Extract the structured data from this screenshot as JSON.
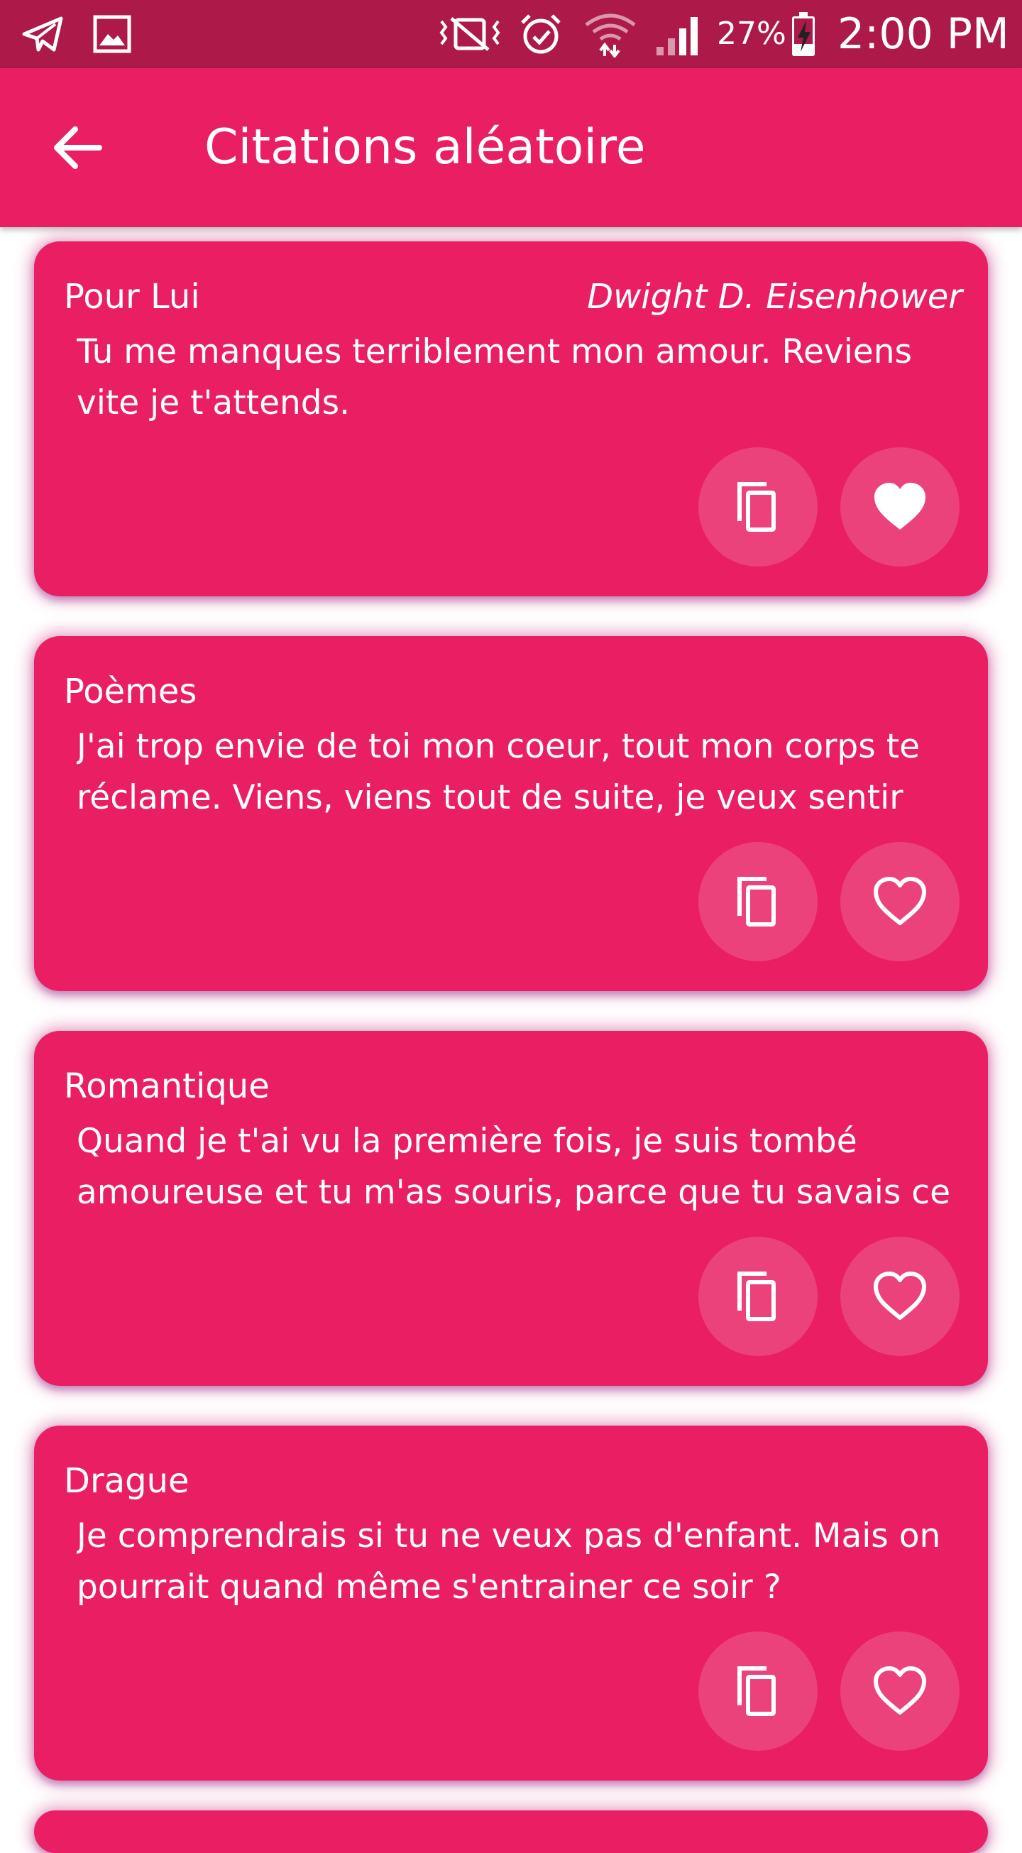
{
  "status_bar": {
    "battery": "27%",
    "time": "2:00 PM",
    "icons": [
      "telegram-icon",
      "gallery-icon",
      "vibrate-icon",
      "alarm-icon",
      "wifi-icon",
      "signal-icon",
      "battery-charging-icon"
    ]
  },
  "app_bar": {
    "title": "Citations aléatoire",
    "back_icon": "arrow-back-icon"
  },
  "colors": {
    "status_bar": "#ad1a4a",
    "primary": "#e91e63",
    "text": "#ffffff"
  },
  "quotes": [
    {
      "category": "Pour Lui",
      "author": "Dwight D. Eisenhower",
      "text": "Tu me manques terriblement mon amour. Reviens vite je t'attends.",
      "favorited": true
    },
    {
      "category": "Poèmes",
      "author": "",
      "text": "J'ai trop envie de toi mon coeur, tout mon corps te réclame. Viens, viens tout de suite, je veux sentir ton souffle dans...",
      "favorited": false
    },
    {
      "category": "Romantique",
      "author": "",
      "text": "Quand je t'ai vu la première fois, je suis tombé amoureuse et tu m'as souris, parce que tu savais ce qui m'arrivait.",
      "favorited": false
    },
    {
      "category": "Drague",
      "author": "",
      "text": "Je comprendrais si tu ne veux pas d'enfant. Mais on pourrait quand même s'entrainer ce soir ?",
      "favorited": false
    }
  ]
}
